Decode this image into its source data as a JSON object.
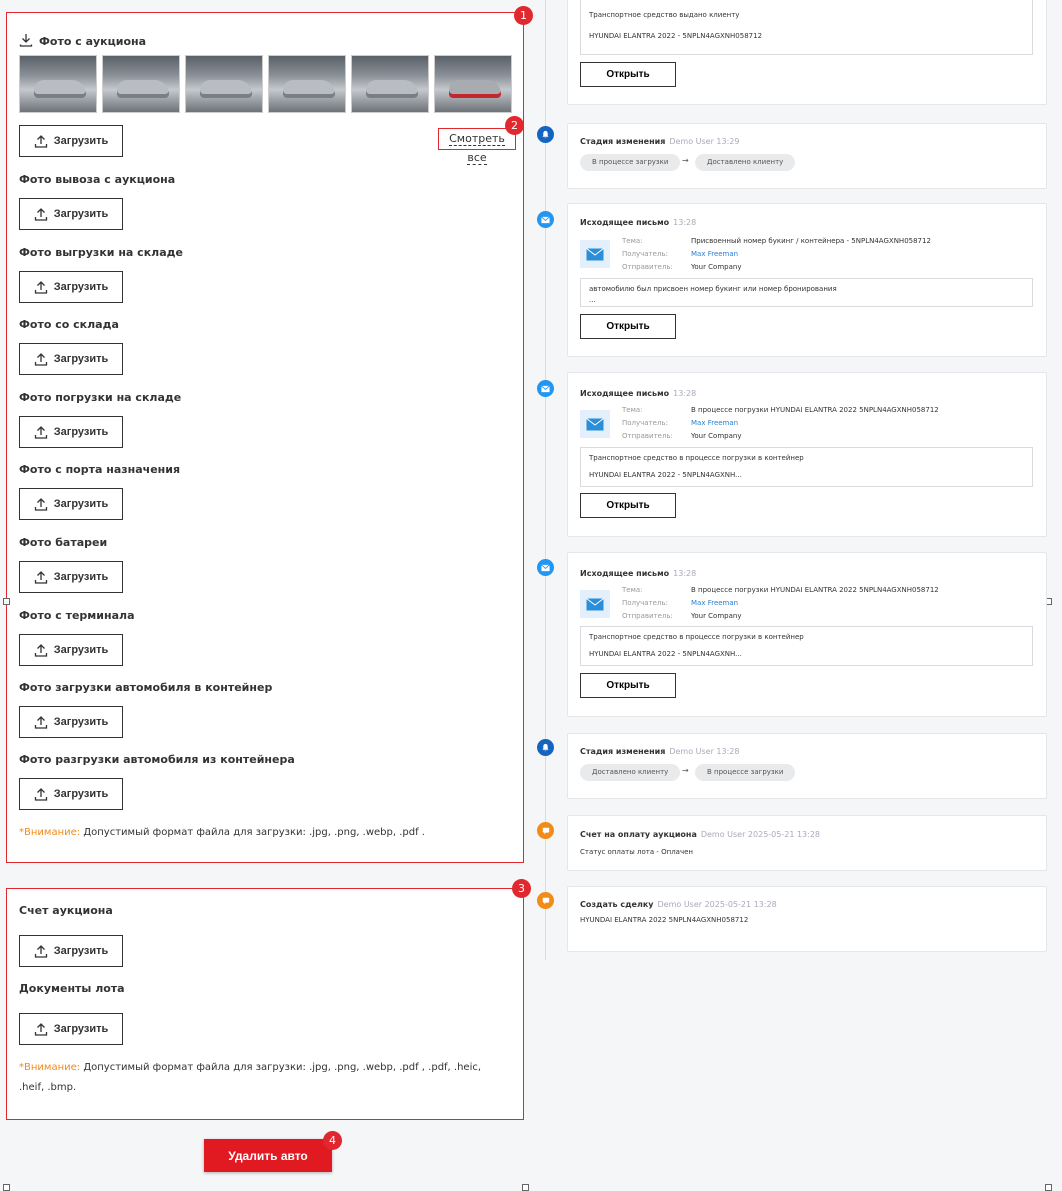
{
  "left": {
    "photo_sections": [
      {
        "title": "Фото с аукциона",
        "upload": "Загрузить"
      },
      {
        "title": "Фото вывоза с аукциона",
        "upload": "Загрузить"
      },
      {
        "title": "Фото выгрузки на складе",
        "upload": "Загрузить"
      },
      {
        "title": "Фото со склада",
        "upload": "Загрузить"
      },
      {
        "title": "Фото погрузки на складе",
        "upload": "Загрузить"
      },
      {
        "title": "Фото с порта назначения",
        "upload": "Загрузить"
      },
      {
        "title": "Фото батареи",
        "upload": "Загрузить"
      },
      {
        "title": "Фото с терминала",
        "upload": "Загрузить"
      },
      {
        "title": "Фото загрузки автомобиля в контейнер",
        "upload": "Загрузить"
      },
      {
        "title": "Фото разгрузки автомобиля из контейнера",
        "upload": "Загрузить"
      }
    ],
    "see_all": "Смотреть все",
    "warning_label": "*Внимание:",
    "warning_photos": "Допустимый формат файла для загрузки: .jpg, .png, .webp, .pdf .",
    "doc_sections": [
      {
        "title": "Счет аукциона",
        "upload": "Загрузить"
      },
      {
        "title": "Документы лота",
        "upload": "Загрузить"
      }
    ],
    "warning_docs": "Допустимый формат файла для загрузки: .jpg, .png, .webp, .pdf , .pdf, .heic, .heif, .bmp.",
    "delete_button": "Удалить авто",
    "badges": [
      "1",
      "2",
      "3",
      "4"
    ]
  },
  "timeline": {
    "top_card": {
      "line1": "Транспортное средство выдано клиенту",
      "line2": "HYUNDAI ELANTRA 2022 - 5NPLN4AGXNH058712",
      "open": "Открыть"
    },
    "stage1": {
      "title": "Стадия изменения",
      "meta": "Demo User 13:29",
      "from": "В процессе загрузки",
      "to": "Доставлено клиенту"
    },
    "mail1": {
      "title": "Исходящее письмо",
      "meta": "13:28",
      "subject_label": "Тема:",
      "subject": "Присвоенный номер букинг / контейнера - 5NPLN4AGXNH058712",
      "recipient_label": "Получатель:",
      "recipient": "Max Freeman",
      "sender_label": "Отправитель:",
      "sender": "Your Company",
      "body1": "автомобилю был присвоен номер букинг или номер бронирования",
      "body2": "...",
      "open": "Открыть"
    },
    "mail2": {
      "title": "Исходящее письмо",
      "meta": "13:28",
      "subject_label": "Тема:",
      "subject": "В процессе погрузки HYUNDAI ELANTRA 2022 5NPLN4AGXNH058712",
      "recipient_label": "Получатель:",
      "recipient": "Max Freeman",
      "sender_label": "Отправитель:",
      "sender": "Your Company",
      "body1": "Транспортное средство в процессе погрузки в контейнер",
      "body2": "HYUNDAI ELANTRA 2022 - 5NPLN4AGXNH...",
      "open": "Открыть"
    },
    "mail3": {
      "title": "Исходящее письмо",
      "meta": "13:28",
      "subject_label": "Тема:",
      "subject": "В процессе погрузки HYUNDAI ELANTRA 2022 5NPLN4AGXNH058712",
      "recipient_label": "Получатель:",
      "recipient": "Max Freeman",
      "sender_label": "Отправитель:",
      "sender": "Your Company",
      "body1": "Транспортное средство в процессе погрузки в контейнер",
      "body2": "HYUNDAI ELANTRA 2022 - 5NPLN4AGXNH...",
      "open": "Открыть"
    },
    "stage2": {
      "title": "Стадия изменения",
      "meta": "Demo User 13:28",
      "from": "Доставлено клиенту",
      "to": "В процессе загрузки"
    },
    "invoice": {
      "title": "Счет на оплату аукциона",
      "meta": "Demo User 2025-05-21 13:28",
      "text": "Статус оплаты лота - Оплачен"
    },
    "deal": {
      "title": "Создать сделку",
      "meta": "Demo User 2025-05-21 13:28",
      "text": "HYUNDAI ELANTRA 2022 5NPLN4AGXNH058712"
    }
  }
}
